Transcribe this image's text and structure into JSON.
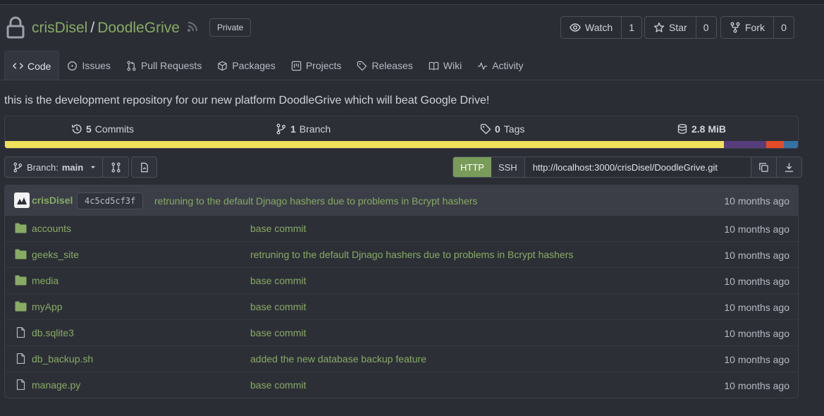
{
  "repo": {
    "owner": "crisDisel",
    "separator": "/",
    "name": "DoodleGrive",
    "visibility": "Private",
    "description": "this is the development repository for our new platform DoodleGrive which will beat Google Drive!"
  },
  "actions": {
    "watch": {
      "label": "Watch",
      "count": "1"
    },
    "star": {
      "label": "Star",
      "count": "0"
    },
    "fork": {
      "label": "Fork",
      "count": "0"
    }
  },
  "tabs": [
    {
      "label": "Code",
      "icon": "code-icon",
      "active": true
    },
    {
      "label": "Issues",
      "icon": "issue-icon"
    },
    {
      "label": "Pull Requests",
      "icon": "pull-request-icon"
    },
    {
      "label": "Packages",
      "icon": "package-icon"
    },
    {
      "label": "Projects",
      "icon": "project-icon"
    },
    {
      "label": "Releases",
      "icon": "tag-icon"
    },
    {
      "label": "Wiki",
      "icon": "book-icon"
    },
    {
      "label": "Activity",
      "icon": "pulse-icon"
    }
  ],
  "stats": {
    "commits_count": "5",
    "commits_label": "Commits",
    "branches_count": "1",
    "branches_label": "Branch",
    "tags_count": "0",
    "tags_label": "Tags",
    "size": "2.8 MiB"
  },
  "languages": [
    {
      "color": "#f1e05a",
      "fraction": 0.907
    },
    {
      "color": "#563d7c",
      "fraction": 0.053
    },
    {
      "color": "#e34c26",
      "fraction": 0.022
    },
    {
      "color": "#3572a5",
      "fraction": 0.018
    }
  ],
  "toolbar": {
    "branch_prefix": "Branch:",
    "branch_name": "main",
    "clone_http": "HTTP",
    "clone_ssh": "SSH",
    "clone_url": "http://localhost:3000/crisDisel/DoodleGrive.git"
  },
  "latest_commit": {
    "author": "crisDisel",
    "sha": "4c5cd5cf3f",
    "message": "retruning to the default Djnago hashers due to problems in Bcrypt hashers",
    "time": "10 months ago"
  },
  "files": [
    {
      "name": "accounts",
      "type": "folder",
      "message": "base commit",
      "time": "10 months ago"
    },
    {
      "name": "geeks_site",
      "type": "folder",
      "message": "retruning to the default Djnago hashers due to problems in Bcrypt hashers",
      "time": "10 months ago"
    },
    {
      "name": "media",
      "type": "folder",
      "message": "base commit",
      "time": "10 months ago"
    },
    {
      "name": "myApp",
      "type": "folder",
      "message": "base commit",
      "time": "10 months ago"
    },
    {
      "name": "db.sqlite3",
      "type": "file",
      "message": "base commit",
      "time": "10 months ago"
    },
    {
      "name": "db_backup.sh",
      "type": "file",
      "message": "added the new database backup feature",
      "time": "10 months ago"
    },
    {
      "name": "manage.py",
      "type": "file",
      "message": "base commit",
      "time": "10 months ago"
    }
  ],
  "colors": {
    "accent_green": "#87ab63",
    "http_active": "#7a9c5b",
    "background": "#2b2d35"
  }
}
